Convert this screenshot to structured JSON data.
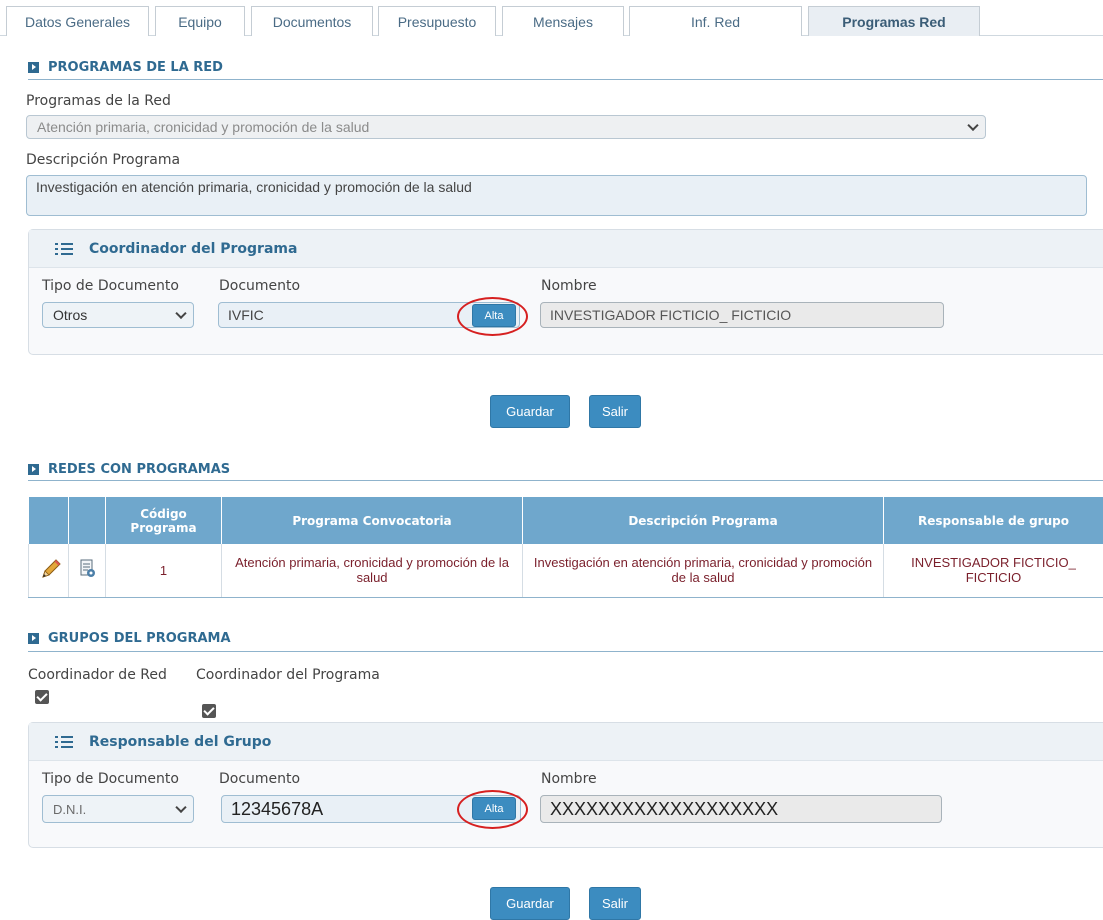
{
  "tabs": [
    "Datos Generales",
    "Equipo",
    "Documentos",
    "Presupuesto",
    "Mensajes",
    "Inf. Red",
    "Programas Red"
  ],
  "active_tab": "Programas Red",
  "programas_section": {
    "title": "PROGRAMAS DE LA RED",
    "programa_label": "Programas de la Red",
    "programa_value": "Atención primaria, cronicidad y promoción de la salud",
    "descripcion_label": "Descripción Programa",
    "descripcion_value": "Investigación en atención primaria, cronicidad y promoción de la salud",
    "coordinador_panel": {
      "title": "Coordinador del Programa",
      "tipo_label": "Tipo de Documento",
      "tipo_value": "Otros",
      "documento_label": "Documento",
      "documento_value": "IVFIC",
      "alta_label": "Alta",
      "nombre_label": "Nombre",
      "nombre_value": "INVESTIGADOR FICTICIO_ FICTICIO"
    },
    "guardar_label": "Guardar",
    "salir_label": "Salir"
  },
  "redes_section": {
    "title": "REDES CON PROGRAMAS",
    "columns": [
      "Código Programa",
      "Programa Convocatoria",
      "Descripción Programa",
      "Responsable de grupo"
    ],
    "rows": [
      {
        "codigo": "1",
        "programa": "Atención primaria, cronicidad y promoción de la salud",
        "descripcion": "Investigación en atención primaria, cronicidad y promoción de la salud",
        "responsable": "INVESTIGADOR FICTICIO_ FICTICIO"
      }
    ]
  },
  "grupos_section": {
    "title": "GRUPOS DEL PROGRAMA",
    "coordinador_red_label": "Coordinador de Red",
    "coordinador_red_checked": true,
    "coordinador_programa_label": "Coordinador del Programa",
    "coordinador_programa_checked": true,
    "responsable_panel": {
      "title": "Responsable del Grupo",
      "tipo_label": "Tipo de Documento",
      "tipo_value": "D.N.I.",
      "documento_label": "Documento",
      "documento_value": "12345678A",
      "alta_label": "Alta",
      "nombre_label": "Nombre",
      "nombre_value": "XXXXXXXXXXXXXXXXXXX"
    },
    "guardar_label": "Guardar",
    "salir_label": "Salir"
  },
  "colors": {
    "accent": "#2f6a91",
    "button": "#3c8cc0",
    "table_header": "#6fa7cc",
    "table_text": "#7a1f2b",
    "highlight_ellipse": "#d62020"
  }
}
